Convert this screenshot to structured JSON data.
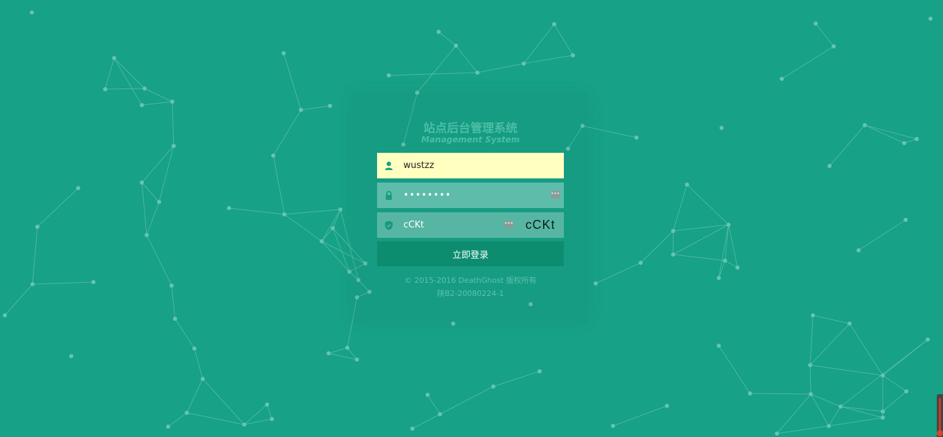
{
  "login": {
    "title": "站点后台管理系统",
    "subtitle": "Management System",
    "username_value": "wustzz",
    "password_value": "••••••••",
    "captcha_input_value": "cCKt",
    "captcha_image_text": "cCKt",
    "login_button": "立即登录",
    "copyright": "© 2015-2016 DeathGhost 版权所有",
    "icp": "陕B2-20080224-1"
  },
  "icons": {
    "username": "user-icon",
    "password": "lock-icon",
    "captcha": "shield-icon",
    "autofill": "password-manager-key-icon"
  },
  "colors": {
    "background": "#17a186",
    "button": "#0d8c70",
    "username_field": "#ffffc0"
  }
}
